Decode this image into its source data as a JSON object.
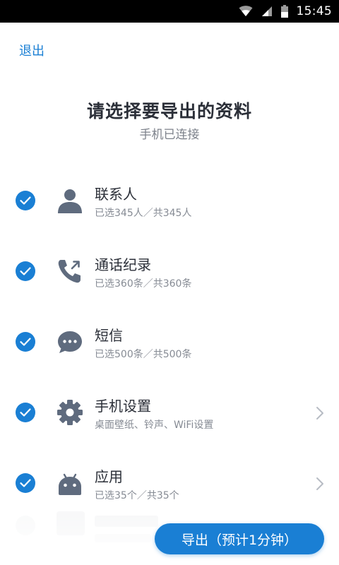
{
  "status_bar": {
    "time": "15:45",
    "icons": [
      "wifi-icon",
      "cellular-signal-icon",
      "battery-icon"
    ]
  },
  "header": {
    "exit_label": "退出",
    "title": "请选择要导出的资料",
    "subtitle": "手机已连接"
  },
  "items": [
    {
      "title": "联系人",
      "subtitle": "已选345人／共345人",
      "icon": "contact-person-icon",
      "checked": true,
      "has_chevron": false
    },
    {
      "title": "通话纪录",
      "subtitle": "已选360条／共360条",
      "icon": "phone-call-icon",
      "checked": true,
      "has_chevron": false
    },
    {
      "title": "短信",
      "subtitle": "已选500条／共500条",
      "icon": "message-bubble-icon",
      "checked": true,
      "has_chevron": false
    },
    {
      "title": "手机设置",
      "subtitle": "桌面壁纸、铃声、WiFi设置",
      "icon": "gear-icon",
      "checked": true,
      "has_chevron": true
    },
    {
      "title": "应用",
      "subtitle": "已选35个／共35个",
      "icon": "android-icon",
      "checked": true,
      "has_chevron": true
    }
  ],
  "export_button": {
    "label": "导出（预计1分钟）"
  },
  "colors": {
    "accent": "#1a7fd4",
    "title_text": "#2b2f38",
    "secondary_text": "#868b94",
    "icon_gray": "#5f6b7e"
  }
}
